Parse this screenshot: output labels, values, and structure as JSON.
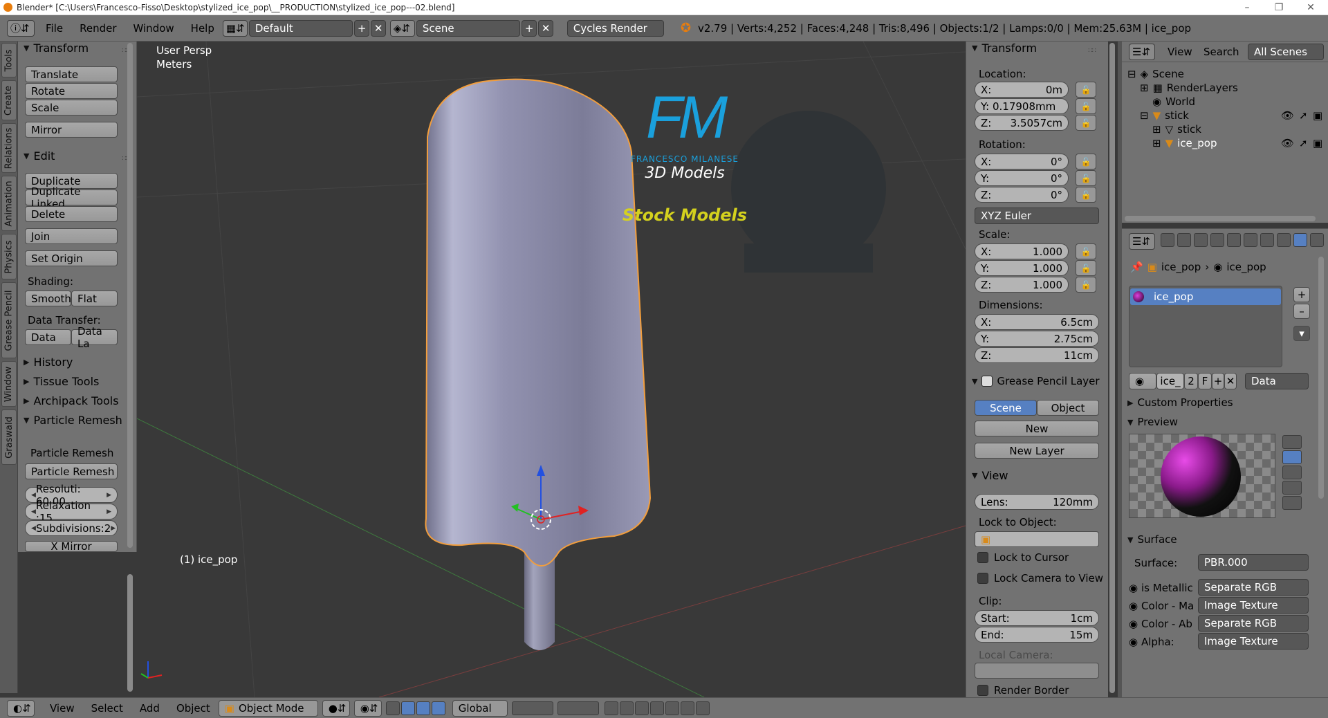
{
  "window": {
    "title": "Blender* [C:\\Users\\Francesco-Fisso\\Desktop\\stylized_ice_pop\\__PRODUCTION\\stylized_ice_pop---02.blend]",
    "minimize": "–",
    "maximize": "❐",
    "close": "✕"
  },
  "topbar": {
    "menus": [
      "File",
      "Render",
      "Window",
      "Help"
    ],
    "layout": "Default",
    "scene": "Scene",
    "engine": "Cycles Render",
    "stats": "v2.79 | Verts:4,252 | Faces:4,248 | Tris:8,496 | Objects:1/2 | Lamps:0/0 | Mem:25.63M | ice_pop"
  },
  "vtabs": [
    "Tools",
    "Create",
    "Relations",
    "Animation",
    "Physics",
    "Grease Pencil",
    "Window",
    "Graswald"
  ],
  "tools": {
    "transform_hdr": "Transform",
    "translate": "Translate",
    "rotate": "Rotate",
    "scale": "Scale",
    "mirror": "Mirror",
    "edit_hdr": "Edit",
    "duplicate": "Duplicate",
    "duplicate_linked": "Duplicate Linked",
    "delete": "Delete",
    "join": "Join",
    "set_origin": "Set Origin",
    "shading_lbl": "Shading:",
    "smooth": "Smooth",
    "flat": "Flat",
    "data_transfer_lbl": "Data Transfer:",
    "data": "Data",
    "data_la": "Data La",
    "history": "History",
    "tissue": "Tissue Tools",
    "archipack": "Archipack Tools",
    "particle_remesh_hdr": "Particle Remesh",
    "particle_remesh_lbl": "Particle Remesh",
    "particle_remesh_btn": "Particle Remesh",
    "resolution": "Resoluti: 60.00",
    "relaxation": "Relaxation :15",
    "subdivisions": "Subdivisions:2",
    "x_mirror": "X Mirror"
  },
  "viewport": {
    "persp": "User Persp",
    "units": "Meters",
    "object_label": "(1) ice_pop",
    "logo_fm": "FM",
    "logo_name": "FRANCESCO MILANESE",
    "logo_sub": "3D Models",
    "logo_stock": "Stock Models",
    "colors": {
      "bg": "#393939",
      "accent": "#1aa0dc",
      "stock": "#d4d11e"
    }
  },
  "npanel": {
    "transform_hdr": "Transform",
    "location_lbl": "Location:",
    "loc_x": [
      "X:",
      "0m"
    ],
    "loc_y": [
      "Y: 0.17908mm",
      ""
    ],
    "loc_z": [
      "Z:",
      "3.5057cm"
    ],
    "rotation_lbl": "Rotation:",
    "rot_x": [
      "X:",
      "0°"
    ],
    "rot_y": [
      "Y:",
      "0°"
    ],
    "rot_z": [
      "Z:",
      "0°"
    ],
    "euler": "XYZ Euler",
    "scale_lbl": "Scale:",
    "scl_x": [
      "X:",
      "1.000"
    ],
    "scl_y": [
      "Y:",
      "1.000"
    ],
    "scl_z": [
      "Z:",
      "1.000"
    ],
    "dimensions_lbl": "Dimensions:",
    "dim_x": [
      "X:",
      "6.5cm"
    ],
    "dim_y": [
      "Y:",
      "2.75cm"
    ],
    "dim_z": [
      "Z:",
      "11cm"
    ],
    "gp_hdr": "Grease Pencil Layer",
    "gp_scene": "Scene",
    "gp_object": "Object",
    "gp_new": "New",
    "gp_new_layer": "New Layer",
    "view_hdr": "View",
    "lens": [
      "Lens:",
      "120mm"
    ],
    "lock_obj_lbl": "Lock to Object:",
    "lock_cursor": "Lock to Cursor",
    "lock_camera": "Lock Camera to View",
    "clip_lbl": "Clip:",
    "clip_start": [
      "Start:",
      "1cm"
    ],
    "clip_end": [
      "End:",
      "15m"
    ],
    "local_camera_lbl": "Local Camera:",
    "render_border": "Render Border"
  },
  "outliner": {
    "view": "View",
    "search": "Search",
    "all_scenes": "All Scenes",
    "rows": [
      "Scene",
      "RenderLayers",
      "World",
      "stick",
      "stick",
      "ice_pop"
    ]
  },
  "props": {
    "crumb_obj": "ice_pop",
    "crumb_mat": "ice_pop",
    "slot": "ice_pop",
    "mat_name": "ice_",
    "users": "2",
    "fake": "F",
    "link": "Data",
    "custom_props": "Custom Properties",
    "preview": "Preview",
    "surface_hdr": "Surface",
    "surface_lbl": "Surface:",
    "surface_val": "PBR.000",
    "rows": [
      {
        "label": "is Metallic",
        "value": "Separate RGB"
      },
      {
        "label": "Color - Ma",
        "value": "Image Texture"
      },
      {
        "label": "Color - Ab",
        "value": "Separate RGB"
      },
      {
        "label": "Alpha:",
        "value": "Image Texture"
      }
    ]
  },
  "bottombar": {
    "view": "View",
    "select": "Select",
    "add": "Add",
    "object": "Object",
    "mode": "Object Mode",
    "orientation": "Global"
  }
}
